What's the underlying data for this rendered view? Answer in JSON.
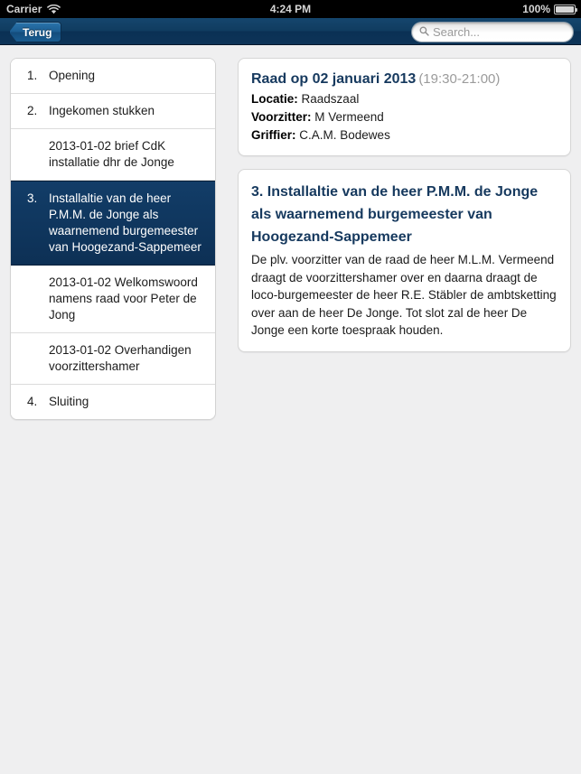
{
  "status_bar": {
    "carrier": "Carrier",
    "wifi_icon": "wifi-icon",
    "time": "4:24 PM",
    "battery_percent": "100%",
    "battery_icon": "battery-icon"
  },
  "nav_bar": {
    "back_label": "Terug",
    "search_placeholder": "Search...",
    "search_value": "",
    "search_icon": "search-icon",
    "background_color": "#0d3458"
  },
  "sidebar": {
    "rows": [
      {
        "num": "1.",
        "label": "Opening",
        "selected": false
      },
      {
        "num": "2.",
        "label": "Ingekomen stukken",
        "selected": false
      },
      {
        "num": "",
        "label": "2013-01-02 brief CdK installatie dhr de Jonge",
        "selected": false
      },
      {
        "num": "3.",
        "label": "Installaltie van de heer P.M.M. de Jonge als waarnemend burgemeester van Hoogezand-Sappemeer",
        "selected": true
      },
      {
        "num": "",
        "label": "2013-01-02 Welkomswoord namens raad voor Peter de Jong",
        "selected": false
      },
      {
        "num": "",
        "label": "2013-01-02 Overhandigen voorzittershamer",
        "selected": false
      },
      {
        "num": "4.",
        "label": "Sluiting",
        "selected": false
      }
    ],
    "selected_color": "#0d3055"
  },
  "detail": {
    "meeting": {
      "title": "Raad op 02 januari 2013",
      "time": "(19:30-21:00)",
      "locatie_label": "Locatie:",
      "locatie_value": "Raadszaal",
      "voorzitter_label": "Voorzitter:",
      "voorzitter_value": "M Vermeend",
      "griffier_label": "Griffier:",
      "griffier_value": "C.A.M. Bodewes"
    },
    "item": {
      "title": "3. Installaltie van de heer P.M.M. de Jonge als waarnemend burgemeester van Hoogezand-Sappemeer",
      "body": "De plv. voorzitter van de raad de heer M.L.M. Vermeend draagt de voorzittershamer over en daarna draagt de loco-burgemeester de heer R.E. Stäbler de ambtsketting over aan de heer De Jonge. Tot slot zal de heer De Jonge een korte toespraak houden.",
      "accent_color": "#16395e"
    }
  }
}
